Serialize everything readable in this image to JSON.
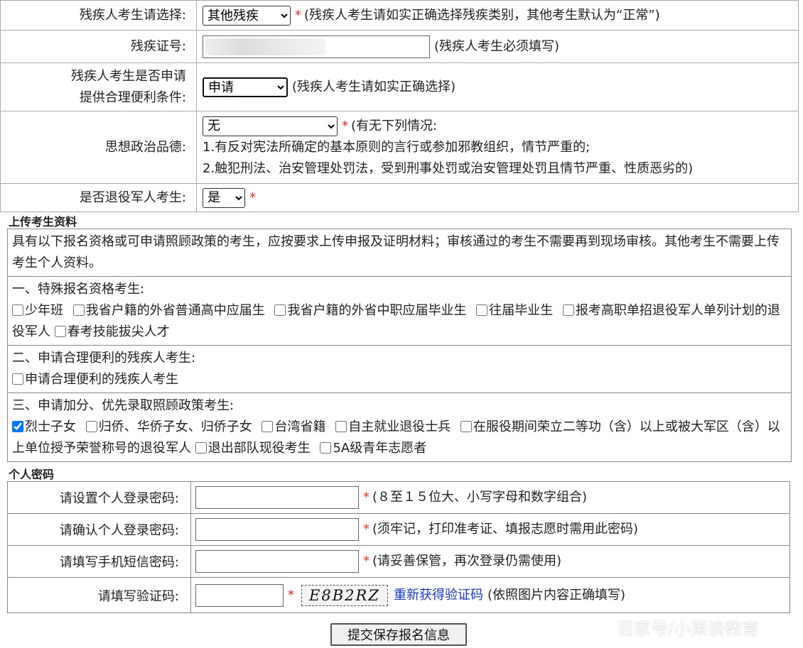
{
  "top": {
    "disability_type": {
      "label": "残疾人考生请选择:",
      "selected": "其他残疾",
      "note": "(残疾人考生请如实正确选择残疾类别，其他考生默认为“正常”)"
    },
    "disability_id": {
      "label": "残疾证号:",
      "value": "",
      "note": "(残疾人考生必须填写)"
    },
    "accommodation": {
      "label_line1": "残疾人考生是否申请",
      "label_line2": "提供合理便利条件:",
      "selected": "申请",
      "note": "(残疾人考生请如实正确选择)"
    },
    "politics": {
      "label": "思想政治品德:",
      "selected": "无",
      "note": "(有无下列情况:",
      "item1": "1.有反对宪法所确定的基本原则的言行或参加邪教组织，情节严重的;",
      "item2": "2.触犯刑法、治安管理处罚法，受到刑事处罚或治安管理处罚且情节严重、性质恶劣的)"
    },
    "veteran": {
      "label": "是否退役军人考生:",
      "selected": "是"
    }
  },
  "upload": {
    "title": "上传考生资料",
    "intro": "具有以下报名资格或可申请照顾政策的考生，应按要求上传申报及证明材料；审核通过的考生不需要再到现场审核。其他考生不需要上传考生个人资料。",
    "sec1": {
      "heading": "一、特殊报名资格考生:",
      "options": [
        "少年班",
        "我省户籍的外省普通高中应届生",
        "我省户籍的外省中职应届毕业生",
        "往届毕业生",
        "报考高职单招退役军人单列计划的退役军人",
        "春考技能拔尖人才"
      ]
    },
    "sec2": {
      "heading": "二、申请合理便利的残疾人考生:",
      "options": [
        "申请合理便利的残疾人考生"
      ]
    },
    "sec3": {
      "heading": "三、申请加分、优先录取照顾政策考生:",
      "options": [
        "烈士子女",
        "归侨、华侨子女、归侨子女",
        "台湾省籍",
        "自主就业退役士兵",
        "在服役期间荣立二等功（含）以上或被大军区（含）以上单位授予荣誉称号的退役军人",
        "退出部队现役考生",
        "5A级青年志愿者"
      ],
      "checked_index": 0
    }
  },
  "password": {
    "title": "个人密码",
    "set": {
      "label": "请设置个人登录密码:",
      "note": "(８至１５位大、小写字母和数字组合)"
    },
    "confirm": {
      "label": "请确认个人登录密码:",
      "note": "(须牢记，打印准考证、填报志愿时需用此密码)"
    },
    "sms": {
      "label": "请填写手机短信密码:",
      "note": "(请妥善保管，再次登录仍需使用)"
    },
    "captcha": {
      "label": "请填写验证码:",
      "image_text": "E8B2RZ",
      "refresh": "重新获得验证码",
      "note": "(依照图片内容正确填写)"
    }
  },
  "submit_label": "提交保存报名信息",
  "watermark": "百家号/小莱谈教育",
  "required_mark": "*"
}
